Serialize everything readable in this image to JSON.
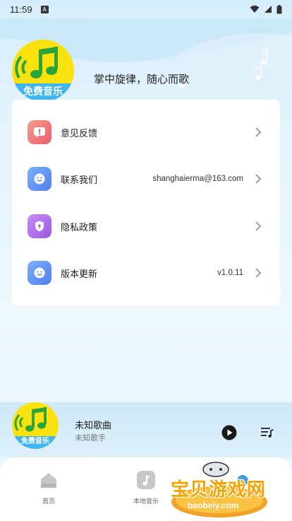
{
  "status_bar": {
    "time": "11:59",
    "notification_icon": "A"
  },
  "header": {
    "logo_badge": "免费音乐",
    "slogan": "掌中旋律，随心而歌"
  },
  "menu": {
    "items": [
      {
        "label": "意见反馈",
        "value": "",
        "icon": "feedback-icon",
        "color": "#ef7373"
      },
      {
        "label": "联系我们",
        "value": "shanghaierma@163.com",
        "icon": "contact-icon",
        "color": "#5b8ff5"
      },
      {
        "label": "隐私政策",
        "value": "",
        "icon": "privacy-shield-icon",
        "color": "#b06ee8"
      },
      {
        "label": "版本更新",
        "value": "v1.0.11",
        "icon": "update-icon",
        "color": "#5b8ff5"
      }
    ]
  },
  "player": {
    "cover_badge": "免费音乐",
    "title": "未知歌曲",
    "artist": "未知歌手"
  },
  "tabbar": {
    "tabs": [
      {
        "label": "首页",
        "icon": "home-icon"
      },
      {
        "label": "本地音乐",
        "icon": "local-music-icon"
      }
    ]
  },
  "watermark": {
    "text": "宝贝游戏网",
    "url": "baobeiy.com"
  }
}
